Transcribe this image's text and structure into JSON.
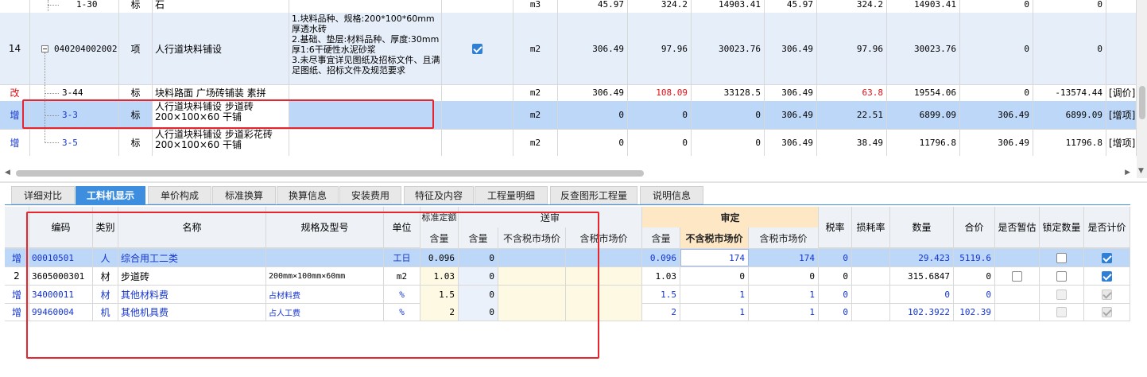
{
  "top_grid": {
    "partial_row": {
      "code": "1-30",
      "type": "标",
      "name": "石",
      "unit": "m3",
      "vals": [
        "45.97",
        "324.2",
        "14903.41",
        "45.97",
        "324.2",
        "14903.41",
        "0",
        "0"
      ]
    },
    "rows": [
      {
        "seq": "14",
        "code": "040204002002",
        "type": "项",
        "name": "人行道块料铺设",
        "feature": "1.块料品种、规格:200*100*60mm厚透水砖\n2.基础、垫层:材料品种、厚度:30mm厚1:6干硬性水泥砂浆\n3.未尽事宜详见图纸及招标文件、且满足图纸、招标文件及规范要求",
        "checked": true,
        "unit": "m2",
        "vals": [
          "306.49",
          "97.96",
          "30023.76",
          "306.49",
          "97.96",
          "30023.76",
          "0",
          "0"
        ],
        "note": ""
      },
      {
        "seq": "改",
        "code": "3-44",
        "type": "标",
        "name": "块料路面 广场砖铺装 素拼",
        "feature": "",
        "unit": "m2",
        "vals": [
          "306.49",
          "108.09",
          "33128.5",
          "306.49",
          "63.8",
          "19554.06",
          "0",
          "-13574.44"
        ],
        "note": "[调价]"
      },
      {
        "seq": "增",
        "code": "3-3",
        "type": "标",
        "name": "人行道块料铺设 步道砖\n200×100×60 干铺",
        "feature": "",
        "unit": "m2",
        "vals": [
          "0",
          "0",
          "0",
          "306.49",
          "22.51",
          "6899.09",
          "306.49",
          "6899.09"
        ],
        "note": "[增项]"
      },
      {
        "seq": "增",
        "code": "3-5",
        "type": "标",
        "name": "人行道块料铺设 步道彩花砖\n200×100×60 干铺",
        "feature": "",
        "unit": "m2",
        "vals": [
          "0",
          "0",
          "0",
          "306.49",
          "38.49",
          "11796.8",
          "306.49",
          "11796.8"
        ],
        "note": "[增项]"
      }
    ]
  },
  "tabs": [
    "详细对比",
    "工料机显示",
    "单价构成",
    "标准换算",
    "换算信息",
    "安装费用",
    "特征及内容",
    "工程量明细",
    "反查图形工程量",
    "说明信息"
  ],
  "active_tab": "工料机显示",
  "grid": {
    "headers": {
      "code": "编码",
      "type": "类别",
      "name": "名称",
      "spec": "规格及型号",
      "unit": "单位",
      "std_quota": "标准定额",
      "std_qty": "含量",
      "sent_group": "送审",
      "sent_qty": "含量",
      "sent_excl": "不含税市场价",
      "sent_incl": "含税市场价",
      "appr_group": "审定",
      "appr_qty": "含量",
      "appr_excl": "不含税市场价",
      "appr_incl": "含税市场价",
      "tax": "税率",
      "loss": "损耗率",
      "amount": "数量",
      "total": "合价",
      "temp": "是否暂估",
      "lock": "锁定数量",
      "count": "是否计价"
    },
    "rows": [
      {
        "seq": "增",
        "code": "00010501",
        "type": "人",
        "name": "综合用工二类",
        "spec": "",
        "unit": "工日",
        "std_qty": "0.096",
        "sent_qty": "0",
        "sent_excl": "",
        "sent_incl": "",
        "appr_qty": "0.096",
        "appr_excl": "174",
        "appr_incl": "174",
        "tax": "0",
        "loss": "",
        "amount": "29.423",
        "total": "5119.6",
        "temp": null,
        "lock": false,
        "count": true
      },
      {
        "seq": "2",
        "code": "3605000301",
        "type": "材",
        "name": "步道砖",
        "spec": "200mm×100mm×60mm",
        "unit": "m2",
        "std_qty": "1.03",
        "sent_qty": "0",
        "sent_excl": "",
        "sent_incl": "",
        "appr_qty": "1.03",
        "appr_excl": "0",
        "appr_incl": "0",
        "tax": "0",
        "loss": "",
        "amount": "315.6847",
        "total": "0",
        "temp": false,
        "lock": false,
        "count": true
      },
      {
        "seq": "增",
        "code": "34000011",
        "type": "材",
        "name": "其他材料费",
        "spec": "占材料费",
        "unit": "%",
        "std_qty": "1.5",
        "sent_qty": "0",
        "sent_excl": "",
        "sent_incl": "",
        "appr_qty": "1.5",
        "appr_excl": "1",
        "appr_incl": "1",
        "tax": "0",
        "loss": "",
        "amount": "0",
        "total": "0",
        "temp": null,
        "lock": "dis",
        "count": "dis"
      },
      {
        "seq": "增",
        "code": "99460004",
        "type": "机",
        "name": "其他机具费",
        "spec": "占人工费",
        "unit": "%",
        "std_qty": "2",
        "sent_qty": "0",
        "sent_excl": "",
        "sent_incl": "",
        "appr_qty": "2",
        "appr_excl": "1",
        "appr_incl": "1",
        "tax": "0",
        "loss": "",
        "amount": "102.3922",
        "total": "102.39",
        "temp": null,
        "lock": "dis",
        "count": "dis"
      }
    ]
  }
}
